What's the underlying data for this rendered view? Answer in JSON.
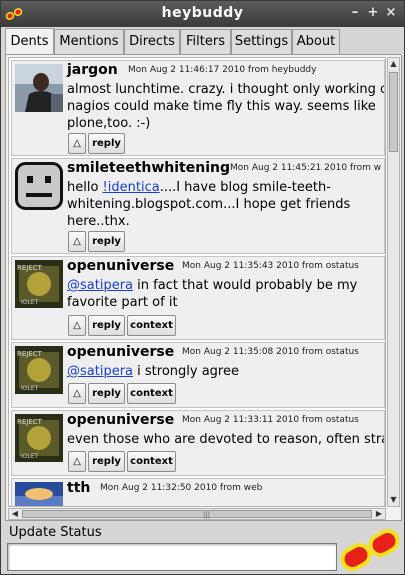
{
  "window": {
    "title": "heybuddy",
    "controls": {
      "minimize": "–",
      "maximize": "+",
      "close": "×"
    }
  },
  "tabs": [
    {
      "label": "Dents",
      "active": true
    },
    {
      "label": "Mentions"
    },
    {
      "label": "Directs"
    },
    {
      "label": "Filters"
    },
    {
      "label": "Settings"
    },
    {
      "label": "About"
    }
  ],
  "dents": [
    {
      "user": "jargon",
      "meta": "Mon Aug  2 11:46:17 2010   from heybuddy",
      "avatar": "photo-avatar",
      "lines": [
        "almost lunchtime. crazy. i thought only working o",
        "nagios could make time fly this way. seems like",
        "plone,too. :-)"
      ],
      "buttons": [
        "△",
        "reply"
      ]
    },
    {
      "user": "smileteethwhitening",
      "meta": "Mon Aug  2 11:45:21 2010   from w",
      "avatar": "default-face-avatar",
      "lines_html": [
        "hello <u class='mention'>!identica</u>....I have blog smile-teeth-",
        "whitening.blogspot.com...I hope get friends",
        "here..thx."
      ],
      "buttons": [
        "△",
        "reply"
      ]
    },
    {
      "user": "openuniverse",
      "meta": "Mon Aug  2 11:35:43 2010   from ostatus",
      "avatar": "reject-avatar",
      "lines_html": [
        "<u class='mention'>@satipera</u> in fact that would probably be my",
        "favorite part of it"
      ],
      "buttons": [
        "△",
        "reply",
        "context"
      ]
    },
    {
      "user": "openuniverse",
      "meta": "Mon Aug  2 11:35:08 2010   from ostatus",
      "avatar": "reject-avatar",
      "lines_html": [
        "<u class='mention'>@satipera</u> i strongly agree"
      ],
      "buttons": [
        "△",
        "reply",
        "context"
      ]
    },
    {
      "user": "openuniverse",
      "meta": "Mon Aug  2 11:33:11 2010   from ostatus",
      "avatar": "reject-avatar",
      "lines": [
        "even those who are devoted to reason, often stra"
      ],
      "buttons": [
        "△",
        "reply",
        "context"
      ]
    },
    {
      "user": "tth",
      "meta": "Mon Aug  2 11:32:50 2010   from web",
      "avatar": "photo-avatar-2",
      "lines": [],
      "buttons": []
    }
  ],
  "update": {
    "label": "Update Status",
    "value": ""
  },
  "colors": {
    "mention": "#1a3fd0",
    "send_button": "#e8201a",
    "send_button_outline": "#f5e21c"
  }
}
